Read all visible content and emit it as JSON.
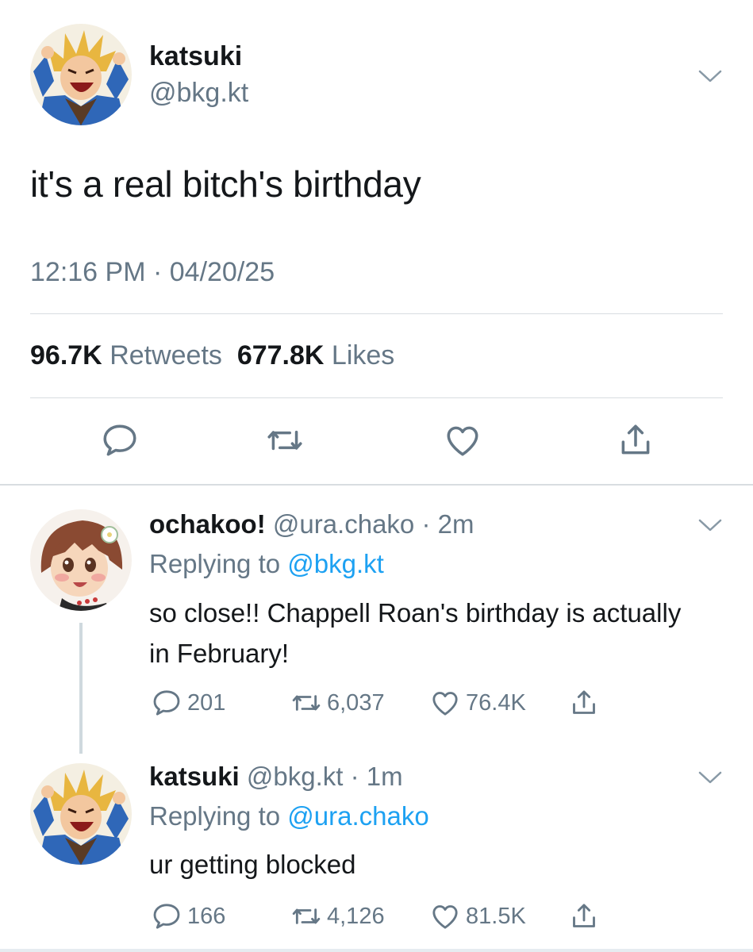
{
  "main_tweet": {
    "name": "katsuki",
    "handle": "@bkg.kt",
    "text": "it's a real bitch's birthday",
    "time": "12:16 PM",
    "date": "04/20/25",
    "retweets_count": "96.7K",
    "retweets_label": "Retweets",
    "likes_count": "677.8K",
    "likes_label": "Likes",
    "avatar_icon": "katsuki-avatar",
    "actions": [
      "reply-icon",
      "retweet-icon",
      "like-icon",
      "share-icon"
    ]
  },
  "replies": [
    {
      "name": "ochakoo!",
      "handle": "@ura.chako",
      "time": "2m",
      "replying_label": "Replying to",
      "replying_to": "@bkg.kt",
      "text": "so close!! Chappell Roan's birthday is actually in February!",
      "reply_count": "201",
      "retweet_count": "6,037",
      "like_count": "76.4K",
      "avatar_icon": "ochako-avatar"
    },
    {
      "name": "katsuki",
      "handle": "@bkg.kt",
      "time": "1m",
      "replying_label": "Replying to",
      "replying_to": "@ura.chako",
      "text": "ur getting blocked",
      "reply_count": "166",
      "retweet_count": "4,126",
      "like_count": "81.5K",
      "avatar_icon": "katsuki-avatar"
    }
  ],
  "colors": {
    "text": "#14171a",
    "secondary": "#657786",
    "link": "#1da1f2",
    "divider": "#d8dde1"
  }
}
